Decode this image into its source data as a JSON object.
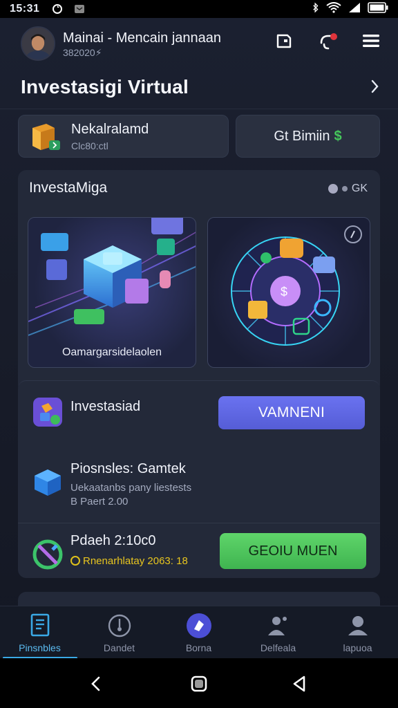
{
  "status_bar": {
    "time": "15:31",
    "icons": [
      "sync-icon",
      "notification-icon",
      "bluetooth-icon",
      "wifi-icon",
      "signal-icon",
      "battery-icon"
    ]
  },
  "header": {
    "user_name": "Mainai - Mencain jannaan",
    "user_sub": "382020⚡",
    "icons": [
      "wallet-icon",
      "notification-bell-icon",
      "menu-icon"
    ]
  },
  "title": {
    "text": "Investasigi Virtual"
  },
  "cards": {
    "card1_title": "Nekalralamd",
    "card1_sub": "Clc80:ctl",
    "card2_label": "Gt Bimiin",
    "card2_glyph": "$"
  },
  "panel": {
    "title": "InvestaMiga",
    "status": "GK",
    "illus1_caption": "Oamargarsidelaolen"
  },
  "list": {
    "row1_title": "Investasiad",
    "row1_button": "VAMNENI",
    "row2_title": "Piosnsles: Gamtek",
    "row2_sub1": "Uekaatanbs pany liestests",
    "row2_sub2": "B Paert 2.00",
    "row3_title": "Pdaeh 2:10c0",
    "row3_sub": "Rnenarhlatay 2063: 18",
    "row3_button": "GEOIU MUEN"
  },
  "nav": {
    "items": [
      {
        "label": "Pinsnbles",
        "icon": "portfolio-icon"
      },
      {
        "label": "Dandet",
        "icon": "shield-icon"
      },
      {
        "label": "Borna",
        "icon": "boost-icon"
      },
      {
        "label": "Delfeala",
        "icon": "people-icon"
      },
      {
        "label": "lapuoa",
        "icon": "profile-icon"
      }
    ],
    "active_index": 0
  },
  "colors": {
    "accent_blue": "#3aa9e6",
    "button_purple": "#5f67e6",
    "button_green": "#4fc45d",
    "card_bg": "#232939"
  }
}
